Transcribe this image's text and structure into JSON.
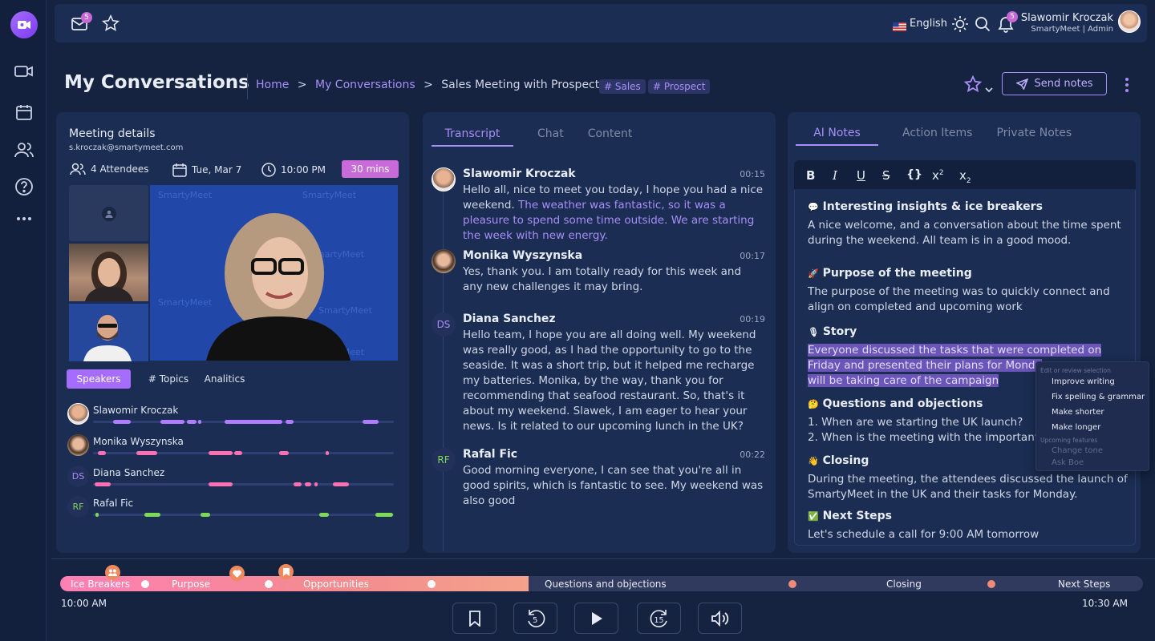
{
  "topbar": {
    "mail_badge": "5",
    "language": "English",
    "notif_badge": "5",
    "user_name": "Slawomir Kroczak",
    "user_role": "SmartyMeet | Admin"
  },
  "page": {
    "title": "My Conversations",
    "breadcrumb_home": "Home",
    "breadcrumb_section": "My Conversations",
    "breadcrumb_current": "Sales Meeting with Prospect....",
    "tags": [
      "# Sales",
      "# Prospect"
    ],
    "send_notes": "Send notes"
  },
  "meeting": {
    "title": "Meeting details",
    "email": "s.kroczak@smartymeet.com",
    "attendees": "4 Attendees",
    "date": "Tue, Mar 7",
    "time": "10:00 PM",
    "duration": "30 mins",
    "tabs": [
      "Speakers",
      "# Topics",
      "Analitics"
    ],
    "speakers": [
      {
        "name": "Slawomir Kroczak",
        "initials": "",
        "color": "#b07cff"
      },
      {
        "name": "Monika Wyszynska",
        "initials": "",
        "color": "#ff6fb4"
      },
      {
        "name": "Diana Sanchez",
        "initials": "DS",
        "color": "#ff6fb4"
      },
      {
        "name": "Rafal Fic",
        "initials": "RF",
        "color": "#7ed957"
      }
    ]
  },
  "transcript": {
    "tabs": [
      "Transcript",
      "Chat",
      "Content"
    ],
    "messages": [
      {
        "name": "Slawomir Kroczak",
        "time": "00:15",
        "initials": "",
        "text": "Hello all, nice to meet you today, I hope you had a nice weekend. ",
        "highlight": "The weather was fantastic, so it was a pleasure to spend some time outside. We are starting the week with new energy."
      },
      {
        "name": "Monika Wyszynska",
        "time": "00:17",
        "initials": "",
        "text": "Yes, thank you. I am totally ready for this week and any new challenges it may bring.",
        "highlight": ""
      },
      {
        "name": "Diana Sanchez",
        "time": "00:19",
        "initials": "DS",
        "text": "Hello team, I hope you are all doing well. My weekend was really good, as I had the opportunity to go to the seaside. It was a short trip, but it helped me recharge my batteries. Monika, by the way, thank you for recommending that seafood restaurant. So, that's it about my weekend. Slawek, I am eager to hear your news. Is it related to our upcoming lunch in the UK?",
        "highlight": ""
      },
      {
        "name": "Rafal Fic",
        "time": "00:22",
        "initials": "RF",
        "text": "Good morning everyone, I can see that you're all in good spirits, which is fantastic to see. My weekend was also good",
        "highlight": ""
      }
    ]
  },
  "notes": {
    "tabs": [
      "AI Notes",
      "Action Items",
      "Private Notes"
    ],
    "sections": [
      {
        "emoji": "💬",
        "title": "Interesting insights & ice breakers",
        "text": "A nice welcome, and a conversation about the time spent during the weekend. All team is in a good mood."
      },
      {
        "emoji": "🚀",
        "title": "Purpose of the meeting",
        "text": "The purpose of the meeting was to quickly connect and align on completed and upcoming work"
      },
      {
        "emoji": "🎙",
        "title": "Story",
        "text": "Everyone discussed the tasks that were completed on Friday and presented their plans for Monday will be taking care of the campaign"
      },
      {
        "emoji": "🤔",
        "title": "Questions and objections",
        "text": "1. When are we starting the UK launch?\n2. When is the meeting with the important c"
      },
      {
        "emoji": "👋",
        "title": "Closing",
        "text": "During the meeting, the attendees discussed the launch of SmartyMeet in the UK and their tasks for Monday."
      },
      {
        "emoji": "✅",
        "title": "Next Steps",
        "text": "Let's schedule a call for 9:00 AM tomorrow"
      }
    ],
    "story_lines": [
      "Everyone discussed the tasks that were completed on",
      "Friday and presented their plans for Monda",
      "will be taking care of the campaign"
    ],
    "question_lines": [
      "1. When are we starting the UK launch?",
      "2. When is the meeting with the important c"
    ],
    "context_menu": {
      "header1": "Edit or review selection",
      "items": [
        "Improve writing",
        "Fix spelling & grammar",
        "Make shorter",
        "Make longer"
      ],
      "header2": "Upcoming features",
      "disabled": [
        "Change tone",
        "Ask Boe"
      ]
    }
  },
  "timeline": {
    "labels": [
      "Ice Breakers",
      "Purpose",
      "Opportunities",
      "Questions and objections",
      "Closing",
      "Next Steps"
    ],
    "start": "10:00 AM",
    "end": "10:30 AM",
    "progress": 0.43
  }
}
